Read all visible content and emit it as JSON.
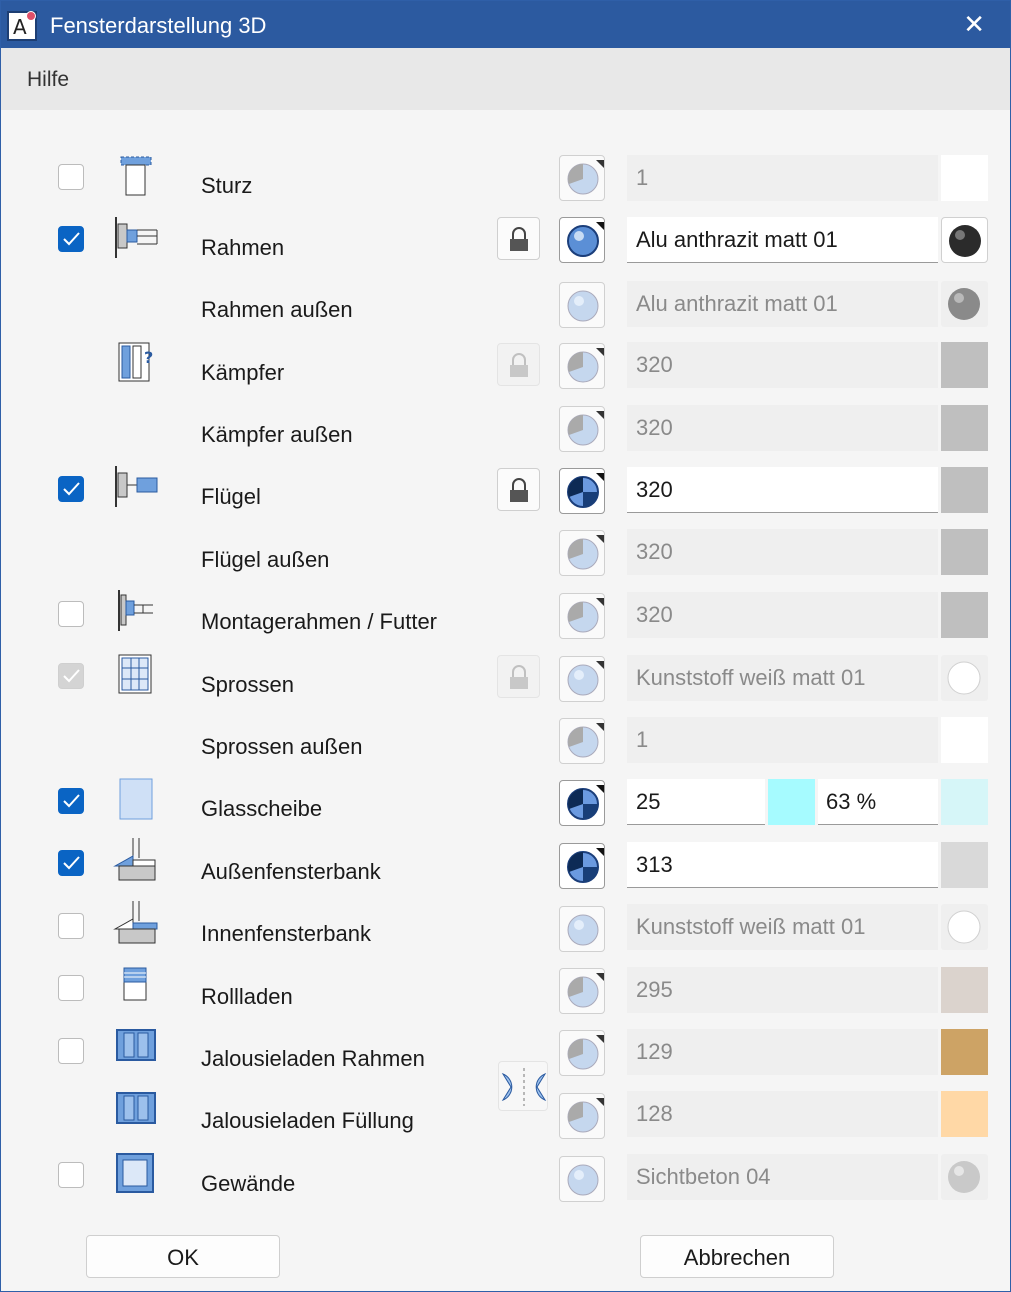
{
  "window": {
    "title": "Fensterdarstellung 3D",
    "close_glyph": "✕",
    "app_icon": "app-a-icon",
    "app_icon_letter": "A"
  },
  "menu": {
    "hilfe": "Hilfe"
  },
  "rows": [
    {
      "label": "Sturz",
      "field": "1"
    },
    {
      "label": "Rahmen",
      "field": "Alu anthrazit matt 01"
    },
    {
      "label": "Rahmen außen",
      "field": "Alu anthrazit matt 01"
    },
    {
      "label": "Kämpfer",
      "field": "320"
    },
    {
      "label": "Kämpfer außen",
      "field": "320"
    },
    {
      "label": "Flügel",
      "field": "320"
    },
    {
      "label": "Flügel außen",
      "field": "320"
    },
    {
      "label": "Montagerahmen / Futter",
      "field": "320"
    },
    {
      "label": "Sprossen",
      "field": "Kunststoff weiß matt 01"
    },
    {
      "label": "Sprossen außen",
      "field": "1"
    },
    {
      "label": "Glasscheibe",
      "field": "25",
      "field2": "63 %"
    },
    {
      "label": "Außenfensterbank",
      "field": "313"
    },
    {
      "label": "Innenfensterbank",
      "field": "Kunststoff weiß matt 01"
    },
    {
      "label": "Rollladen",
      "field": "295"
    },
    {
      "label": "Jalousieladen Rahmen",
      "field": "129"
    },
    {
      "label": "Jalousieladen Füllung",
      "field": "128"
    },
    {
      "label": "Gewände",
      "field": "Sichtbeton 04"
    }
  ],
  "colors": {
    "white": "#ffffff",
    "gray": "#bfbfbf",
    "light_gray": "#d9d9d9",
    "cyan": "#a6fbff",
    "light_cyan": "#d6f6f8",
    "rollladen": "#dbd3cd",
    "jalousie_rahmen": "#cda365",
    "jalousie_fuellung": "#ffd8a6",
    "accent": "#0a64c4",
    "titlebar": "#2c5aa0"
  },
  "buttons": {
    "ok": "OK",
    "cancel": "Abbrechen"
  }
}
